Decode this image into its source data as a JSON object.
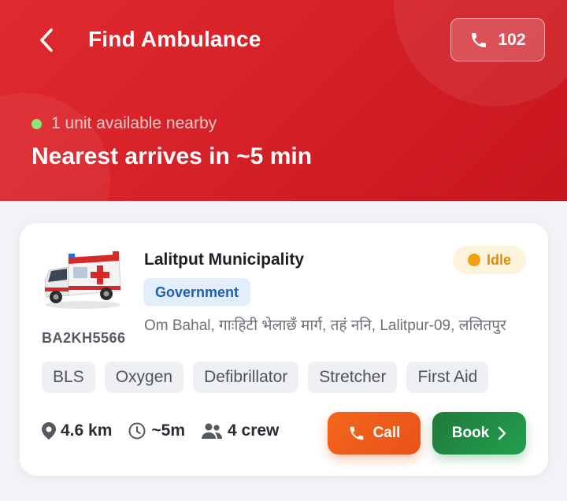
{
  "header": {
    "title": "Find Ambulance",
    "emergency_number": "102",
    "availability_text": "1 unit available nearby",
    "eta_text": "Nearest arrives in ~5 min"
  },
  "unit": {
    "name": "Lalitput Municipality",
    "type_badge": "Government",
    "status": "Idle",
    "address": "Om Bahal, गाःहिटी भेलाछँ मार्ग, तहं ननि, Lalitpur-09, ललितपुर",
    "plate": "BA2KH5566",
    "tags": [
      "BLS",
      "Oxygen",
      "Defibrillator",
      "Stretcher",
      "First Aid"
    ],
    "distance": "4.6 km",
    "eta": "~5m",
    "crew": "4 crew",
    "call_label": "Call",
    "book_label": "Book"
  },
  "icons": {
    "back": "chevron-left-icon",
    "phone": "phone-icon",
    "location": "location-pin-icon",
    "clock": "clock-icon",
    "crew": "people-icon",
    "book_arrow": "chevron-right-icon",
    "ambulance": "ambulance-image"
  },
  "colors": {
    "header": "#d41f26",
    "status_idle": "#f0a20e",
    "available_dot": "#8ee67a",
    "call": "#ec5a1b",
    "book": "#1f8d45",
    "government_badge": "#1f5fb0"
  }
}
